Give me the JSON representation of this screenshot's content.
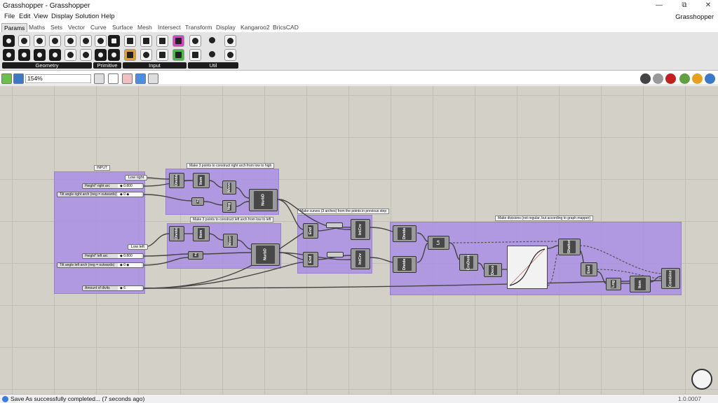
{
  "window": {
    "title": "Grasshopper - Grasshopper",
    "min": "—",
    "restore": "⧉",
    "close": "✕"
  },
  "menu": {
    "items": [
      "File",
      "Edit",
      "View",
      "Display",
      "Solution",
      "Help"
    ],
    "app_name": "Grasshopper"
  },
  "tabs": [
    "Params",
    "Maths",
    "Sets",
    "Vector",
    "Curve",
    "Surface",
    "Mesh",
    "Intersect",
    "Transform",
    "Display",
    "Kangaroo2",
    "BricsCAD"
  ],
  "ribbon": {
    "groups": [
      "Geometry",
      "Primitive",
      "Input",
      "Util"
    ]
  },
  "toolbar": {
    "zoom": "154%"
  },
  "canvas": {
    "groups": {
      "input": "INPUT",
      "right_arch": "Make 3 points to construct right arch from low to high",
      "left_arch": "Make 3 points to construct left arch from low to left",
      "curves": "Make curves (3 arches) from the points in previous step",
      "divisions": "Make divisions (not regular, but according to graph mapper)"
    },
    "params": {
      "low_right": "Low right",
      "low_left": "Low left"
    },
    "sliders": [
      {
        "name": "Height* right arc",
        "value": "◆ 0.800"
      },
      {
        "name": "Tilt angle right arch (neg = outwards)",
        "value": "◆ 0 ◆"
      },
      {
        "name": "Height* left arc",
        "value": "◆ 0.800"
      },
      {
        "name": "Tilt angle left arch (neg = outwards)",
        "value": "◆ 0 ◆"
      },
      {
        "name": "Amount of divits",
        "value": "◆ 6"
      }
    ],
    "components": [
      "Divide",
      "Item",
      "Move",
      "Z",
      "Neg",
      "NurbD",
      "Divide",
      "Item",
      "Move",
      "Z",
      "NurbD",
      "End",
      "IntCrv",
      "End",
      "IntCrv",
      "Divide",
      "Divide",
      "Ln",
      "CrvDom",
      "Deco",
      "Shatter",
      "Eval",
      "Lng",
      "Item",
      "Combine"
    ]
  },
  "status": {
    "message": "Save As successfully completed... (7 seconds ago)",
    "version": "1.0.0007"
  }
}
